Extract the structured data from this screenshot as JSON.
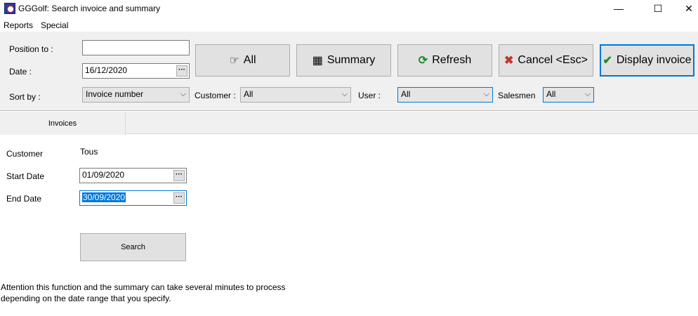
{
  "window": {
    "title": "GGGolf: Search invoice and summary",
    "minimize": "—",
    "maximize": "☐",
    "close": "✕"
  },
  "menu": {
    "reports": "Reports",
    "special": "Special"
  },
  "toolbar": {
    "position_label": "Position to :",
    "position_value": "",
    "date_label": "Date :",
    "date_value": "16/12/2020",
    "sortby_label": "Sort by :",
    "sortby_value": "Invoice number",
    "customer_label": "Customer :",
    "customer_value": "All",
    "user_label": "User :",
    "user_value": "All",
    "salesmen_label": "Salesmen",
    "salesmen_value": "All",
    "buttons": {
      "all": "All",
      "summary": "Summary",
      "refresh": "Refresh",
      "cancel": "Cancel <Esc>",
      "display_invoice": "Display invoice"
    },
    "dots": "···"
  },
  "tabs": {
    "invoices": "Invoices"
  },
  "form": {
    "customer_label": "Customer",
    "customer_value": "Tous",
    "start_label": "Start Date",
    "start_value": "01/09/2020",
    "end_label": "End Date",
    "end_value": "30/09/2020",
    "search_button": "Search"
  },
  "notice": "Attention this function and the summary can take several minutes to process depending on the date range that you specify.",
  "colors": {
    "accent": "#0078d7",
    "cancel_icon": "#c0392b",
    "check_icon": "#1e8a2e",
    "refresh_icon": "#1e8a2e"
  }
}
